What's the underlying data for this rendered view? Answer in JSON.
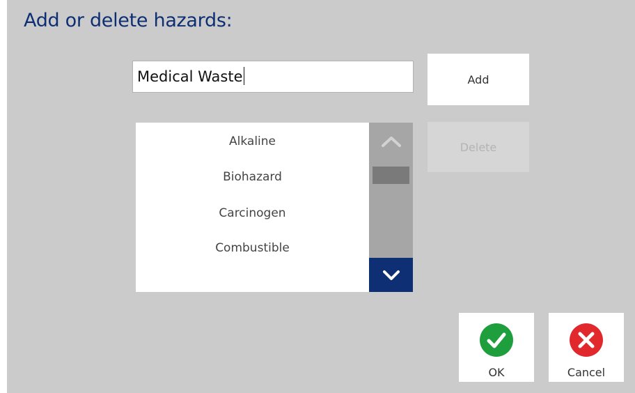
{
  "dialog": {
    "title": "Add or delete hazards:"
  },
  "input": {
    "value": "Medical Waste"
  },
  "buttons": {
    "add_label": "Add",
    "delete_label": "Delete",
    "ok_label": "OK",
    "cancel_label": "Cancel"
  },
  "hazard_list": {
    "items": [
      "Alkaline",
      "Biohazard",
      "Carcinogen",
      "Combustible"
    ]
  },
  "icons": {
    "ok": "check-circle-icon",
    "cancel": "x-circle-icon",
    "scroll_up": "chevron-up-icon",
    "scroll_down": "chevron-down-icon"
  },
  "colors": {
    "title": "#0e2f73",
    "background": "#cbcbcb",
    "ok_green": "#1f9e3e",
    "cancel_red": "#e1282d",
    "scroll_down_bg": "#0e2f73",
    "scrollbar_track": "#a6a6a6"
  }
}
